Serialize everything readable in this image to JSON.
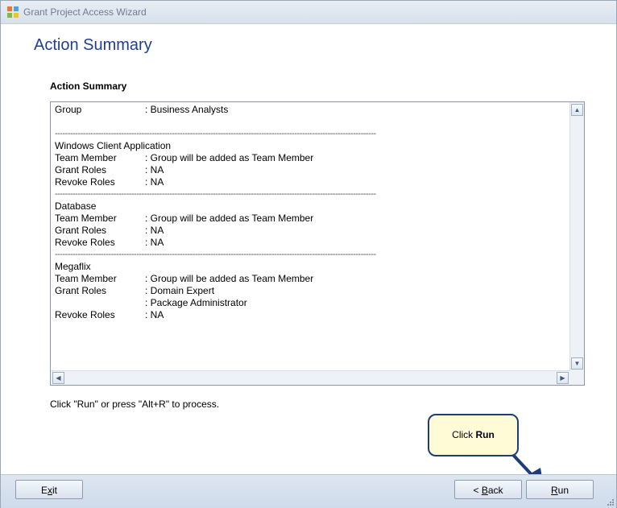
{
  "window": {
    "title": "Grant Project Access Wizard"
  },
  "page": {
    "heading": "Action Summary",
    "section_label": "Action Summary"
  },
  "summary": {
    "lines": [
      {
        "type": "kv",
        "key": "Group",
        "value": ": Business Analysts"
      },
      {
        "type": "blank"
      },
      {
        "type": "sep",
        "text": "------------------------------------------------------------------------------------------------------------------------------"
      },
      {
        "type": "text",
        "text": "Windows Client Application"
      },
      {
        "type": "kv",
        "key": "Team Member",
        "value": ": Group will be added as Team Member"
      },
      {
        "type": "kv",
        "key": "Grant Roles",
        "value": ": NA"
      },
      {
        "type": "kv",
        "key": "Revoke Roles",
        "value": ": NA"
      },
      {
        "type": "sep",
        "text": "------------------------------------------------------------------------------------------------------------------------------"
      },
      {
        "type": "text",
        "text": "Database"
      },
      {
        "type": "kv",
        "key": "Team Member",
        "value": ": Group will be added as Team Member"
      },
      {
        "type": "kv",
        "key": "Grant Roles",
        "value": ": NA"
      },
      {
        "type": "kv",
        "key": "Revoke Roles",
        "value": ": NA"
      },
      {
        "type": "sep",
        "text": "------------------------------------------------------------------------------------------------------------------------------"
      },
      {
        "type": "text",
        "text": "Megaflix"
      },
      {
        "type": "kv",
        "key": "Team Member",
        "value": ": Group will be added as Team Member"
      },
      {
        "type": "kv",
        "key": "Grant Roles",
        "value": ": Domain Expert"
      },
      {
        "type": "kv",
        "key": "",
        "value": ": Package Administrator"
      },
      {
        "type": "kv",
        "key": "Revoke Roles",
        "value": ": NA"
      }
    ]
  },
  "hint": "Click \"Run\" or press \"Alt+R\" to process.",
  "callout": {
    "prefix": "Click ",
    "emphasis": "Run"
  },
  "buttons": {
    "exit": {
      "label": "Exit",
      "mnemonic_index": 1
    },
    "back": {
      "label": "< Back",
      "mnemonic_index": 2
    },
    "run": {
      "label": "Run",
      "mnemonic_index": 0
    }
  },
  "colors": {
    "heading": "#1f3f8f",
    "callout_fill": "#fffbd6",
    "callout_border": "#1d3d78"
  }
}
